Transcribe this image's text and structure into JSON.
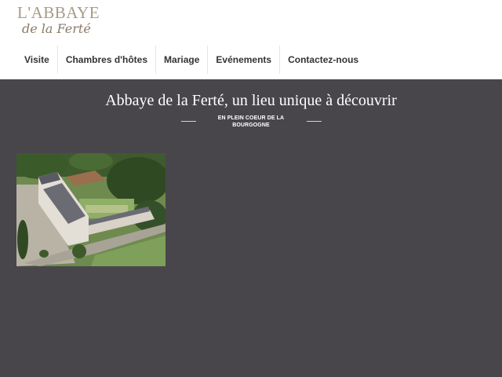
{
  "logo": {
    "line1": "L'ABBAYE",
    "line2": "de la Ferté"
  },
  "nav": {
    "items": [
      {
        "label": "Visite"
      },
      {
        "label": "Chambres d'hôtes"
      },
      {
        "label": "Mariage"
      },
      {
        "label": "Evénements"
      },
      {
        "label": "Contactez-nous"
      }
    ]
  },
  "hero": {
    "title": "Abbaye de la Ferté, un lieu unique à découvrir",
    "subtitle": "EN PLEIN COEUR DE LA BOURGOGNE"
  },
  "colors": {
    "background": "#48464b",
    "header": "#ffffff",
    "logo": "#a89a86",
    "nav_text": "#333333"
  }
}
